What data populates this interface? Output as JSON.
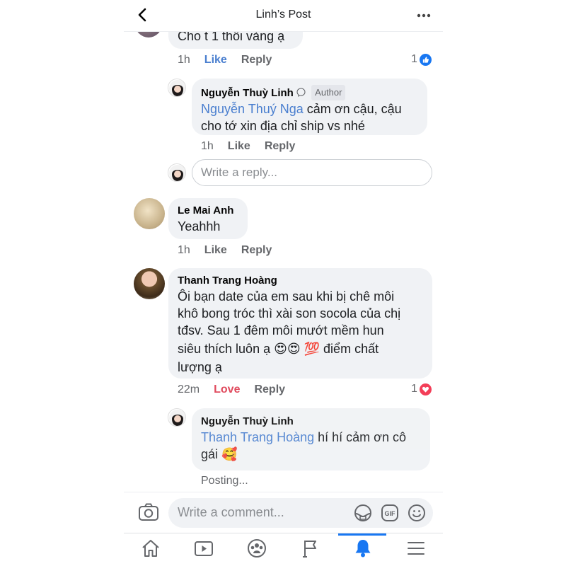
{
  "header": {
    "title": "Linh’s Post"
  },
  "comments": {
    "top_partial": {
      "text": "Cho t 1 thôi vàng ạ",
      "time": "1h",
      "like_label": "Like",
      "reply_label": "Reply",
      "reaction_count": "1",
      "reaction": "like"
    },
    "reply1": {
      "author": "Nguyễn Thuỳ Linh",
      "badge": "Author",
      "mention": "Nguyễn Thuý Nga",
      "text_line1": " cảm ơn cậu, cậu",
      "text_line2": "cho tớ xin địa chỉ ship vs nhé",
      "time": "1h",
      "like_label": "Like",
      "reply_label": "Reply"
    },
    "reply_box": {
      "placeholder": "Write a reply..."
    },
    "comment2": {
      "author": "Le Mai Anh",
      "text": "Yeahhh",
      "time": "1h",
      "like_label": "Like",
      "reply_label": "Reply"
    },
    "comment3": {
      "author": "Thanh Trang Hoàng",
      "line1": "Ôi bạn date của em sau khi bị chê môi",
      "line2": "khô bong tróc thì xài son socola của chị",
      "line3": "tđsv. Sau 1 đêm môi mướt mềm hun",
      "line4_text": "siêu thích luôn ạ ",
      "line4_emoji": "😍😍 💯",
      "line4_tail": " điểm chất",
      "line5": "lượng ạ",
      "time": "22m",
      "love_label": "Love",
      "reply_label": "Reply",
      "reaction_count": "1",
      "reaction": "love"
    },
    "reply2": {
      "author": "Nguyễn Thuỳ Linh",
      "mention": "Thanh Trang Hoàng",
      "text_line1": " hí hí cảm ơn cô",
      "text_line2": "gái ",
      "emoji": "🥰",
      "status": "Posting..."
    }
  },
  "composer": {
    "placeholder": "Write a comment...",
    "icons": [
      "camera-icon",
      "sticker-icon",
      "gif-icon",
      "emoji-icon"
    ]
  },
  "tabbar": {
    "tabs": [
      "home-icon",
      "watch-icon",
      "groups-icon",
      "pages-icon",
      "notifications-icon",
      "menu-icon"
    ],
    "active": "notifications-icon"
  },
  "colors": {
    "accent": "#1877f2",
    "mention": "#4a7fcf",
    "love": "#e04b5e",
    "bubble": "#f0f2f5"
  }
}
